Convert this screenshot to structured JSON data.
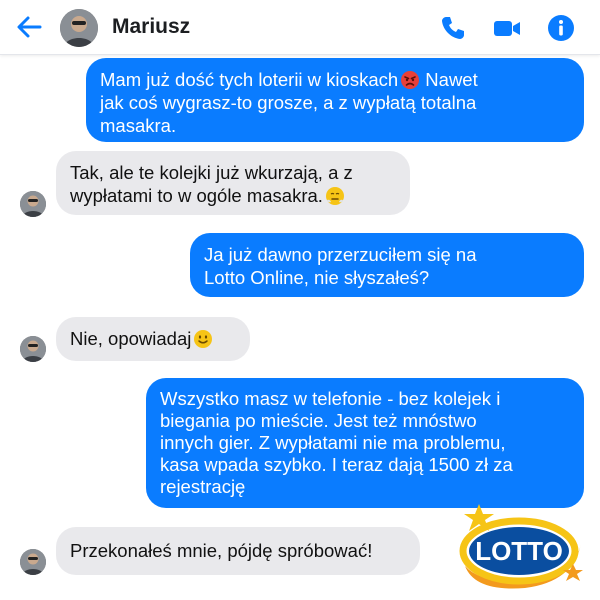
{
  "header": {
    "contact_name": "Mariusz",
    "icons": {
      "back": "arrow-left-icon",
      "phone": "phone-icon",
      "video": "video-camera-icon",
      "info": "info-icon"
    },
    "accent_color": "#0a7cff"
  },
  "messages": [
    {
      "direction": "out",
      "text": "Mam już dość tych loterii w kioskach",
      "emoji": "angry-face",
      "text_after": " Nawet\njak coś wygrasz-to grosze, a z wypłatą totalna\nmasakra."
    },
    {
      "direction": "in",
      "text": "Tak, ale te kolejki już wkurzają, a z\nwypłatami to w ogóle masakra.",
      "emoji": "steam-face"
    },
    {
      "direction": "out",
      "text": "Ja już dawno przerzuciłem się na\nLotto Online, nie słyszałeś?"
    },
    {
      "direction": "in",
      "text": "Nie, opowiadaj",
      "emoji": "slightly-smiling-face"
    },
    {
      "direction": "out",
      "text": "Wszystko masz w telefonie - bez kolejek i\nbiegania po mieście. Jest też mnóstwo\ninnych gier. Z wypłatami nie ma problemu,\nkasa wpada szybko. I teraz dają 1500 zł za\nrejestrację"
    },
    {
      "direction": "in",
      "text": "Przekonałeś mnie, pójdę spróbować!"
    }
  ],
  "logo": {
    "text": "LOTTO",
    "colors": {
      "blue": "#0a4ea0",
      "yellow": "#f6c416",
      "orange": "#f39a1e"
    }
  }
}
